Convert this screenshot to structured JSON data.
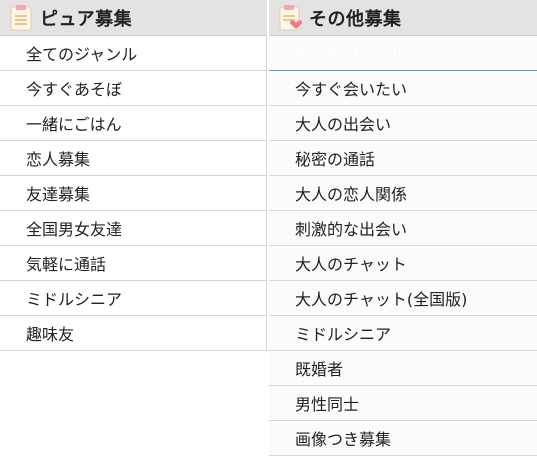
{
  "left_panel": {
    "title": "ピュア募集",
    "icon": "notepad-icon",
    "items": [
      {
        "label": "全てのジャンル"
      },
      {
        "label": "今すぐあそぼ"
      },
      {
        "label": "一緒にごはん"
      },
      {
        "label": "恋人募集"
      },
      {
        "label": "友達募集"
      },
      {
        "label": "全国男女友達"
      },
      {
        "label": "気軽に通話"
      },
      {
        "label": "ミドルシニア"
      },
      {
        "label": "趣味友"
      }
    ]
  },
  "right_panel": {
    "title": "その他募集",
    "icon": "notepad-heart-icon",
    "active_index": 0,
    "items": [
      {
        "label": "全てのジャンル"
      },
      {
        "label": "今すぐ会いたい"
      },
      {
        "label": "大人の出会い"
      },
      {
        "label": "秘密の通話"
      },
      {
        "label": "大人の恋人関係"
      },
      {
        "label": "刺激的な出会い"
      },
      {
        "label": "大人のチャット"
      },
      {
        "label": "大人のチャット(全国版)"
      },
      {
        "label": "ミドルシニア"
      },
      {
        "label": "既婚者"
      },
      {
        "label": "男性同士"
      },
      {
        "label": "画像つき募集"
      }
    ]
  },
  "colors": {
    "active_bg": "#4c9fe6",
    "header_bg": "#e3e3e3",
    "icon_pink": "#f07a8a"
  }
}
